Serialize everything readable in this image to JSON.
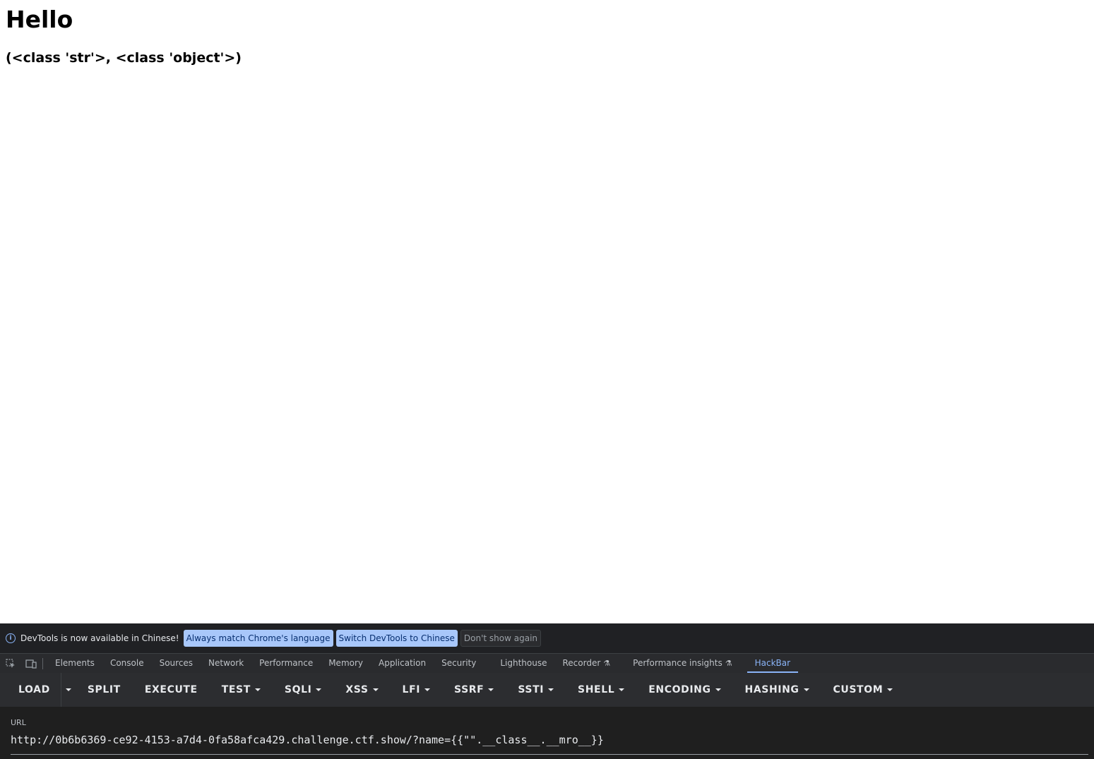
{
  "page": {
    "heading": "Hello",
    "output": "(<class 'str'>, <class 'object'>)"
  },
  "devtools": {
    "infobar": {
      "message": "DevTools is now available in Chinese!",
      "btn_match_language": "Always match Chrome's language",
      "btn_switch_chinese": "Switch DevTools to Chinese",
      "btn_dont_show": "Don't show again"
    },
    "tabs": [
      {
        "label": "Elements"
      },
      {
        "label": "Console"
      },
      {
        "label": "Sources"
      },
      {
        "label": "Network"
      },
      {
        "label": "Performance"
      },
      {
        "label": "Memory"
      },
      {
        "label": "Application"
      },
      {
        "label": "Security"
      },
      {
        "label": "Lighthouse"
      },
      {
        "label": "Recorder"
      },
      {
        "label": "Performance insights"
      },
      {
        "label": "HackBar",
        "active": true
      }
    ],
    "accent_color": "#8ab4f8"
  },
  "hackbar": {
    "buttons": {
      "load": "LOAD",
      "split": "SPLIT",
      "execute": "EXECUTE",
      "test": "TEST",
      "sqli": "SQLI",
      "xss": "XSS",
      "lfi": "LFI",
      "ssrf": "SSRF",
      "ssti": "SSTI",
      "shell": "SHELL",
      "encoding": "ENCODING",
      "hashing": "HASHING",
      "custom": "CUSTOM"
    },
    "url_label": "URL",
    "url_value": "http://0b6b6369-ce92-4153-a7d4-0fa58afca429.challenge.ctf.show/?name={{\"\".__class__.__mro__}}"
  }
}
